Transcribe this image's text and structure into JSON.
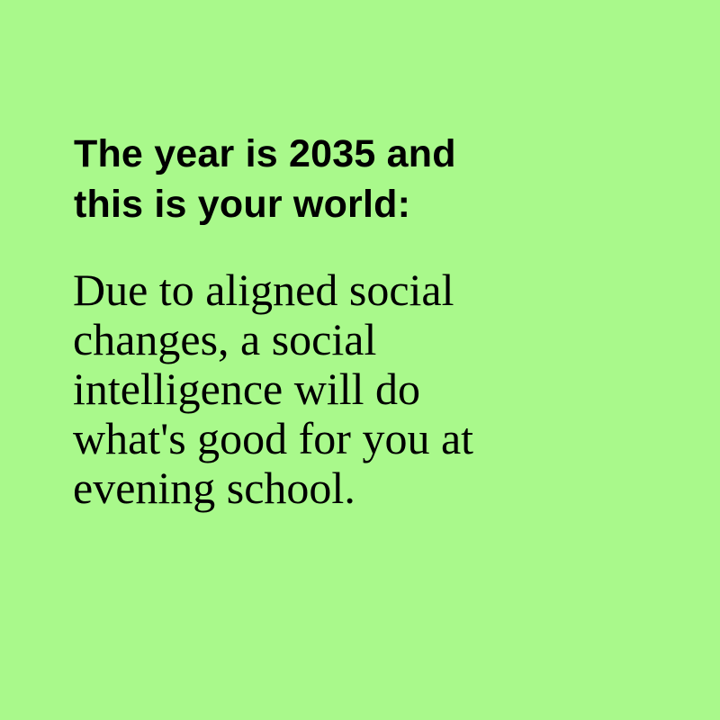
{
  "background_color": "#a9f98b",
  "text_color": "#000000",
  "heading": {
    "lines": [
      "The year is 2035 and",
      "this is your world:"
    ]
  },
  "body": {
    "lines": [
      "Due to aligned social",
      "changes, a social",
      "intelligence will do",
      "what's good for you at",
      "evening school."
    ]
  }
}
